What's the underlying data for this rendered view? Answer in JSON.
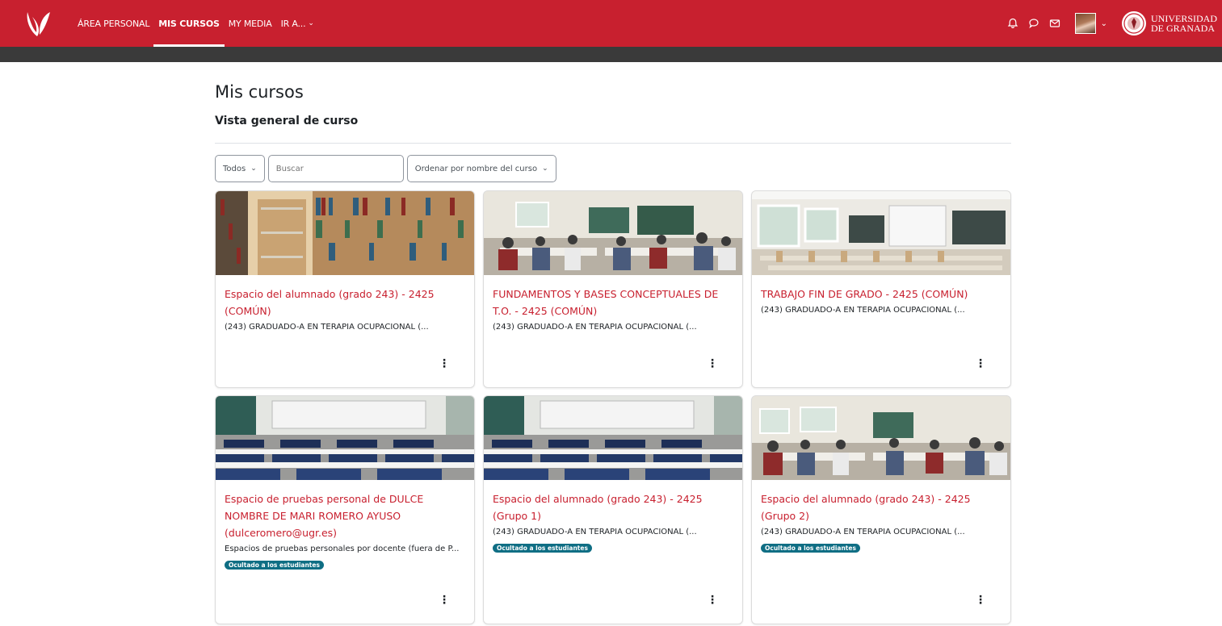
{
  "navbar": {
    "links": [
      {
        "label": "ÁREA PERSONAL",
        "active": false
      },
      {
        "label": "MIS CURSOS",
        "active": true
      },
      {
        "label": "MY MEDIA",
        "active": false
      },
      {
        "label": "IR A...",
        "active": false
      }
    ],
    "brand_line1": "UNIVERSIDAD",
    "brand_line2": "DE GRANADA",
    "icons": [
      "bell-icon",
      "chat-icon",
      "mail-icon"
    ],
    "color_primary": "#c8202f"
  },
  "page": {
    "title": "Mis cursos",
    "section": "Vista general de curso"
  },
  "filters": {
    "grouping": "Todos",
    "search_placeholder": "Buscar",
    "sort": "Ordenar por nombre del curso"
  },
  "courses": [
    {
      "name": "Espacio del alumnado (grado 243) - 2425 (COMÚN)",
      "category": "(243) GRADUADO-A EN TERAPIA OCUPACIONAL (...",
      "hidden": "",
      "image": "library"
    },
    {
      "name": "FUNDAMENTOS Y BASES CONCEPTUALES DE T.O. - 2425 (COMÚN)",
      "category": "(243) GRADUADO-A EN TERAPIA OCUPACIONAL (...",
      "hidden": "",
      "image": "classroom-students"
    },
    {
      "name": "TRABAJO FIN DE GRADO - 2425 (COMÚN)",
      "category": "(243) GRADUADO-A EN TERAPIA OCUPACIONAL (...",
      "hidden": "",
      "image": "empty-classroom"
    },
    {
      "name": "Espacio de pruebas personal de DULCE NOMBRE DE MARI ROMERO AYUSO (dulceromero@ugr.es)",
      "category": "Espacios de pruebas personales por docente (fuera de P...",
      "hidden": "Ocultado a los estudiantes",
      "image": "lecture-hall"
    },
    {
      "name": "Espacio del alumnado (grado 243) - 2425 (Grupo 1)",
      "category": "(243) GRADUADO-A EN TERAPIA OCUPACIONAL (...",
      "hidden": "Ocultado a los estudiantes",
      "image": "lecture-hall"
    },
    {
      "name": "Espacio del alumnado (grado 243) - 2425 (Grupo 2)",
      "category": "(243) GRADUADO-A EN TERAPIA OCUPACIONAL (...",
      "hidden": "Ocultado a los estudiantes",
      "image": "classroom-students"
    }
  ],
  "menu_glyph": "⋮"
}
